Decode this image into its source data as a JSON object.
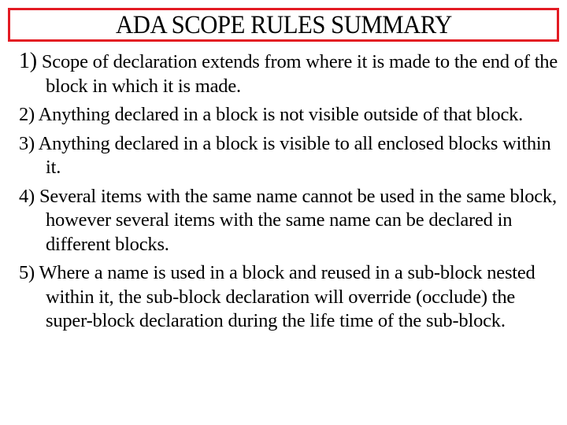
{
  "title": "ADA SCOPE RULES SUMMARY",
  "colors": {
    "title_border": "#e31b23",
    "text": "#000000",
    "background": "#ffffff"
  },
  "rules": [
    {
      "number": "1)",
      "text": "Scope of declaration extends from where it is made to the end of the block in which it is made."
    },
    {
      "number": "2)",
      "text": "Anything declared in a block is not visible outside of that block."
    },
    {
      "number": "3)",
      "text": "Anything declared in a block is visible to all enclosed blocks within it."
    },
    {
      "number": "4)",
      "text": "Several items with the same name cannot be used in the same block, however several items with the same name can be declared in different blocks."
    },
    {
      "number": "5)",
      "text": "Where a name is used in a block and reused in a sub-block nested within it, the sub-block declaration will override (occlude) the super-block declaration during the life time of the sub-block."
    }
  ]
}
